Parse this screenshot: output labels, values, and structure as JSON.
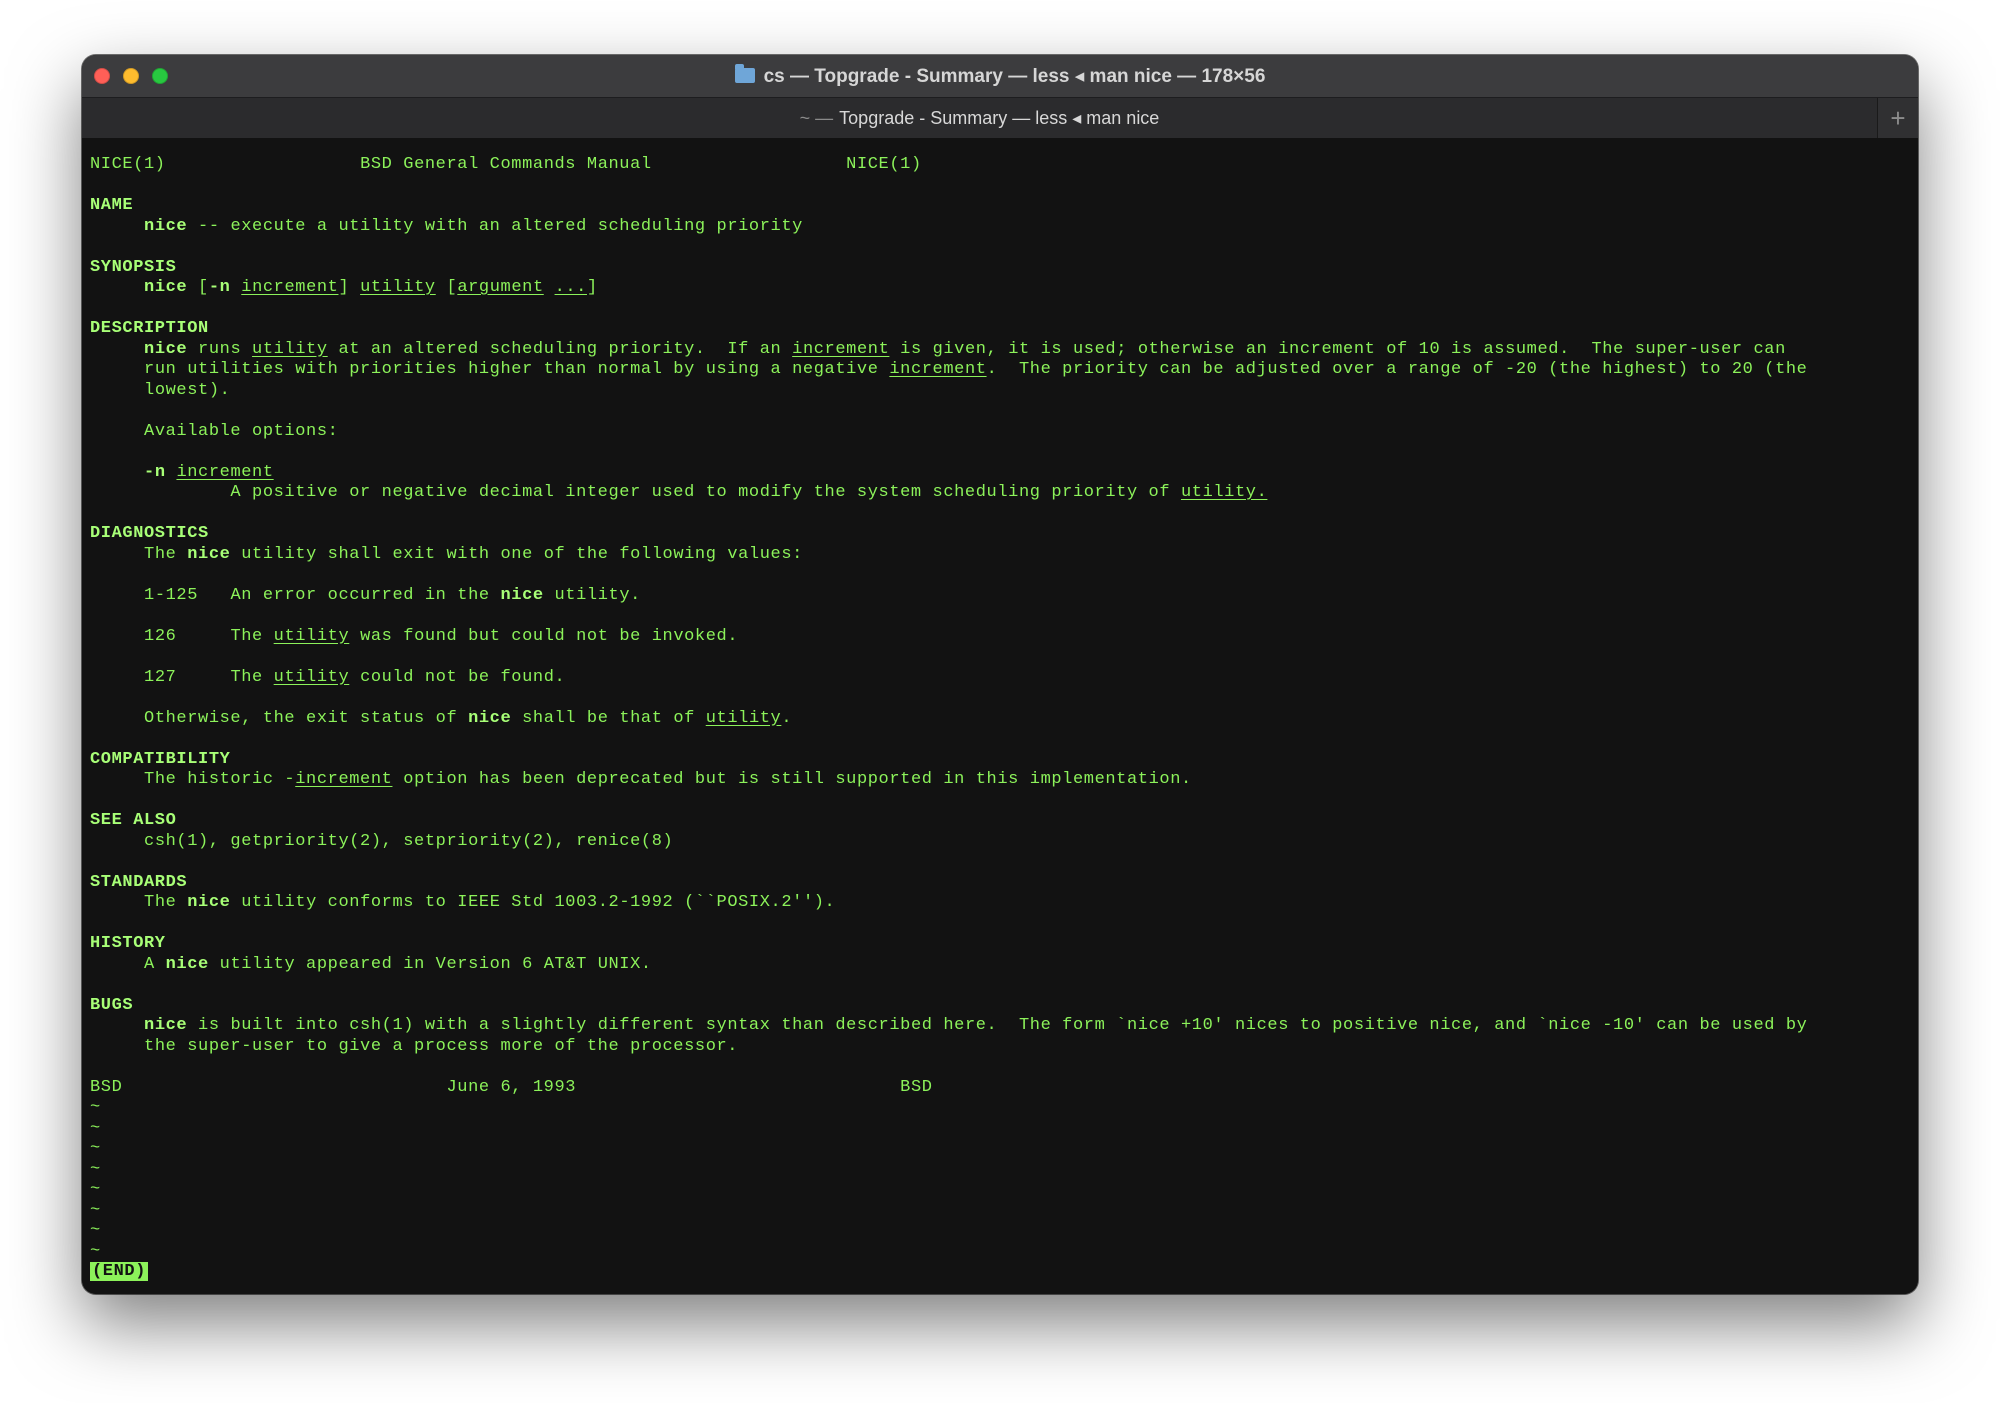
{
  "window": {
    "title": "cs — Topgrade - Summary — less ◂ man nice — 178×56",
    "tab_prefix": "~ —",
    "tab_label": "Topgrade - Summary — less ◂ man nice",
    "new_tab_symbol": "+",
    "icons": [
      "close-button",
      "minimize-button",
      "zoom-button",
      "folder-icon",
      "plus-icon"
    ],
    "colors": {
      "terminal_bg": "#121212",
      "text_green": "#8cf25a",
      "titlebar": "#3c3c3e"
    }
  },
  "man": {
    "header_left": "NICE(1)",
    "header_center": "BSD General Commands Manual",
    "header_right": "NICE(1)",
    "name_heading": "NAME",
    "name_cmd": "nice",
    "name_desc": " -- execute a utility with an altered scheduling priority",
    "synopsis_heading": "SYNOPSIS",
    "synopsis_cmd": "nice",
    "synopsis_open": " [",
    "synopsis_flag": "-n",
    "synopsis_sp": " ",
    "synopsis_increment": "increment",
    "synopsis_close": "] ",
    "synopsis_utility": "utility",
    "synopsis_open2": " [",
    "synopsis_argument": "argument",
    "synopsis_sp2": " ",
    "synopsis_dots": "...",
    "synopsis_close2": "]",
    "description_heading": "DESCRIPTION",
    "desc_l1_a": "nice",
    "desc_l1_b": " runs ",
    "desc_l1_c": "utility",
    "desc_l1_d": " at an altered scheduling priority.  If an ",
    "desc_l1_e": "increment",
    "desc_l1_f": " is given, it is used; otherwise an increment of 10 is assumed.  The super-user can",
    "desc_l2_a": "run utilities with priorities higher than normal by using a negative ",
    "desc_l2_b": "increment",
    "desc_l2_c": ".  The priority can be adjusted over a range of -20 (the highest) to 20 (the",
    "desc_l3": "lowest).",
    "available_options": "Available options:",
    "opt_flag": "-n",
    "opt_sp": " ",
    "opt_increment": "increment",
    "opt_desc_a": "A positive or negative decimal integer used to modify the system scheduling priority of ",
    "opt_desc_b": "utility.",
    "diagnostics_heading": "DIAGNOSTICS",
    "diag_intro_a": "The ",
    "diag_intro_b": "nice",
    "diag_intro_c": " utility shall exit with one of the following values:",
    "diag_1_code": "1-125",
    "diag_1_a": "An error occurred in the ",
    "diag_1_b": "nice",
    "diag_1_c": " utility.",
    "diag_2_code": "126",
    "diag_2_a": "The ",
    "diag_2_b": "utility",
    "diag_2_c": " was found but could not be invoked.",
    "diag_3_code": "127",
    "diag_3_a": "The ",
    "diag_3_b": "utility",
    "diag_3_c": " could not be found.",
    "diag_other_a": "Otherwise, the exit status of ",
    "diag_other_b": "nice",
    "diag_other_c": " shall be that of ",
    "diag_other_d": "utility",
    "diag_other_e": ".",
    "compat_heading": "COMPATIBILITY",
    "compat_a": "The historic -",
    "compat_b": "increment",
    "compat_c": " option has been deprecated but is still supported in this implementation.",
    "see_also_heading": "SEE ALSO",
    "see_also": "csh(1), getpriority(2), setpriority(2), renice(8)",
    "standards_heading": "STANDARDS",
    "standards_a": "The ",
    "standards_b": "nice",
    "standards_c": " utility conforms to IEEE Std 1003.2-1992 (``POSIX.2'').",
    "history_heading": "HISTORY",
    "history_a": "A ",
    "history_b": "nice",
    "history_c": " utility appeared in Version 6 AT&T UNIX.",
    "bugs_heading": "BUGS",
    "bugs_l1_a": "nice",
    "bugs_l1_b": " is built into csh(1) with a slightly different syntax than described here.  The form `nice +10' nices to positive nice, and `nice -10' can be used by",
    "bugs_l2": "the super-user to give a process more of the processor.",
    "footer_left": "BSD",
    "footer_center": "June 6, 1993",
    "footer_right": "BSD",
    "tilde": "~",
    "end_marker": "(END)"
  }
}
